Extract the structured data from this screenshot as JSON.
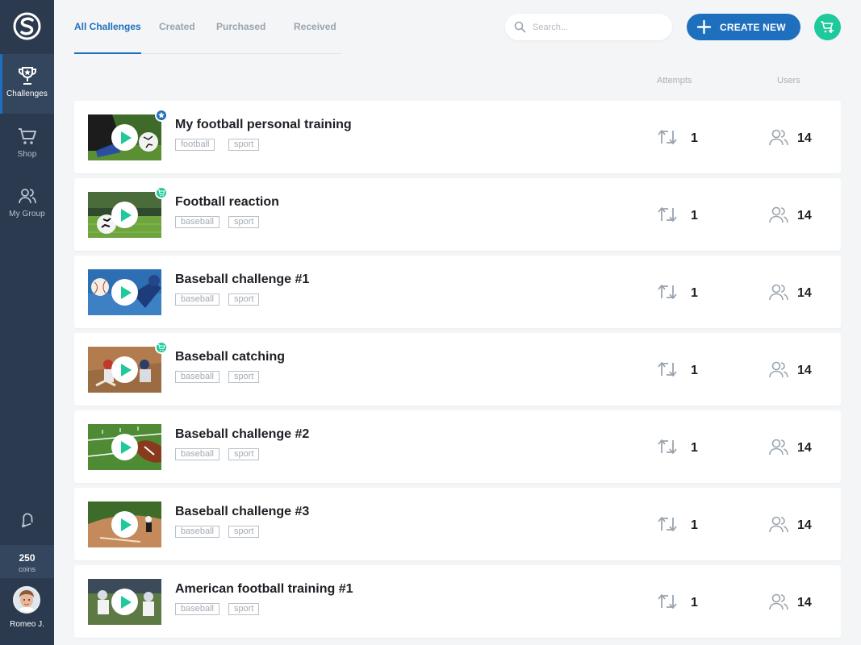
{
  "sidebar": {
    "items": [
      {
        "label": "Challenges",
        "icon": "trophy-icon",
        "active": true
      },
      {
        "label": "Shop",
        "icon": "cart-icon",
        "active": false
      },
      {
        "label": "My Group",
        "icon": "group-icon",
        "active": false
      }
    ],
    "coins": {
      "value": "250",
      "label": "coins"
    },
    "user": {
      "name": "Romeo J."
    }
  },
  "tabs": [
    {
      "label": "All Challenges",
      "active": true
    },
    {
      "label": "Created",
      "active": false
    },
    {
      "label": "Purchased",
      "active": false
    },
    {
      "label": "Received",
      "active": false
    }
  ],
  "search": {
    "placeholder": "Search..."
  },
  "actions": {
    "create_label": "CREATE NEW"
  },
  "columns": {
    "attempts": "Attempts",
    "users": "Users"
  },
  "colors": {
    "accent": "#1e6fbd",
    "green": "#1ec99b",
    "sidebar": "#2b3a4f"
  },
  "challenges": [
    {
      "title": "My football personal training",
      "tags": [
        "football",
        "sport"
      ],
      "attempts": "1",
      "users": "14",
      "badge": "star",
      "thumb": "football-cleats"
    },
    {
      "title": "Football reaction",
      "tags": [
        "baseball",
        "sport"
      ],
      "attempts": "1",
      "users": "14",
      "badge": "cart",
      "thumb": "soccer-ball-field"
    },
    {
      "title": "Baseball challenge #1",
      "tags": [
        "baseball",
        "sport"
      ],
      "attempts": "1",
      "users": "14",
      "badge": "",
      "thumb": "baseball-pitch"
    },
    {
      "title": "Baseball catching",
      "tags": [
        "baseball",
        "sport"
      ],
      "attempts": "1",
      "users": "14",
      "badge": "cart",
      "thumb": "baseball-plate"
    },
    {
      "title": "Baseball challenge #2",
      "tags": [
        "baseball",
        "sport"
      ],
      "attempts": "1",
      "users": "14",
      "badge": "",
      "thumb": "american-football"
    },
    {
      "title": "Baseball challenge #3",
      "tags": [
        "baseball",
        "sport"
      ],
      "attempts": "1",
      "users": "14",
      "badge": "",
      "thumb": "baseball-infield"
    },
    {
      "title": "American football training #1",
      "tags": [
        "baseball",
        "sport"
      ],
      "attempts": "1",
      "users": "14",
      "badge": "",
      "thumb": "football-players"
    }
  ]
}
